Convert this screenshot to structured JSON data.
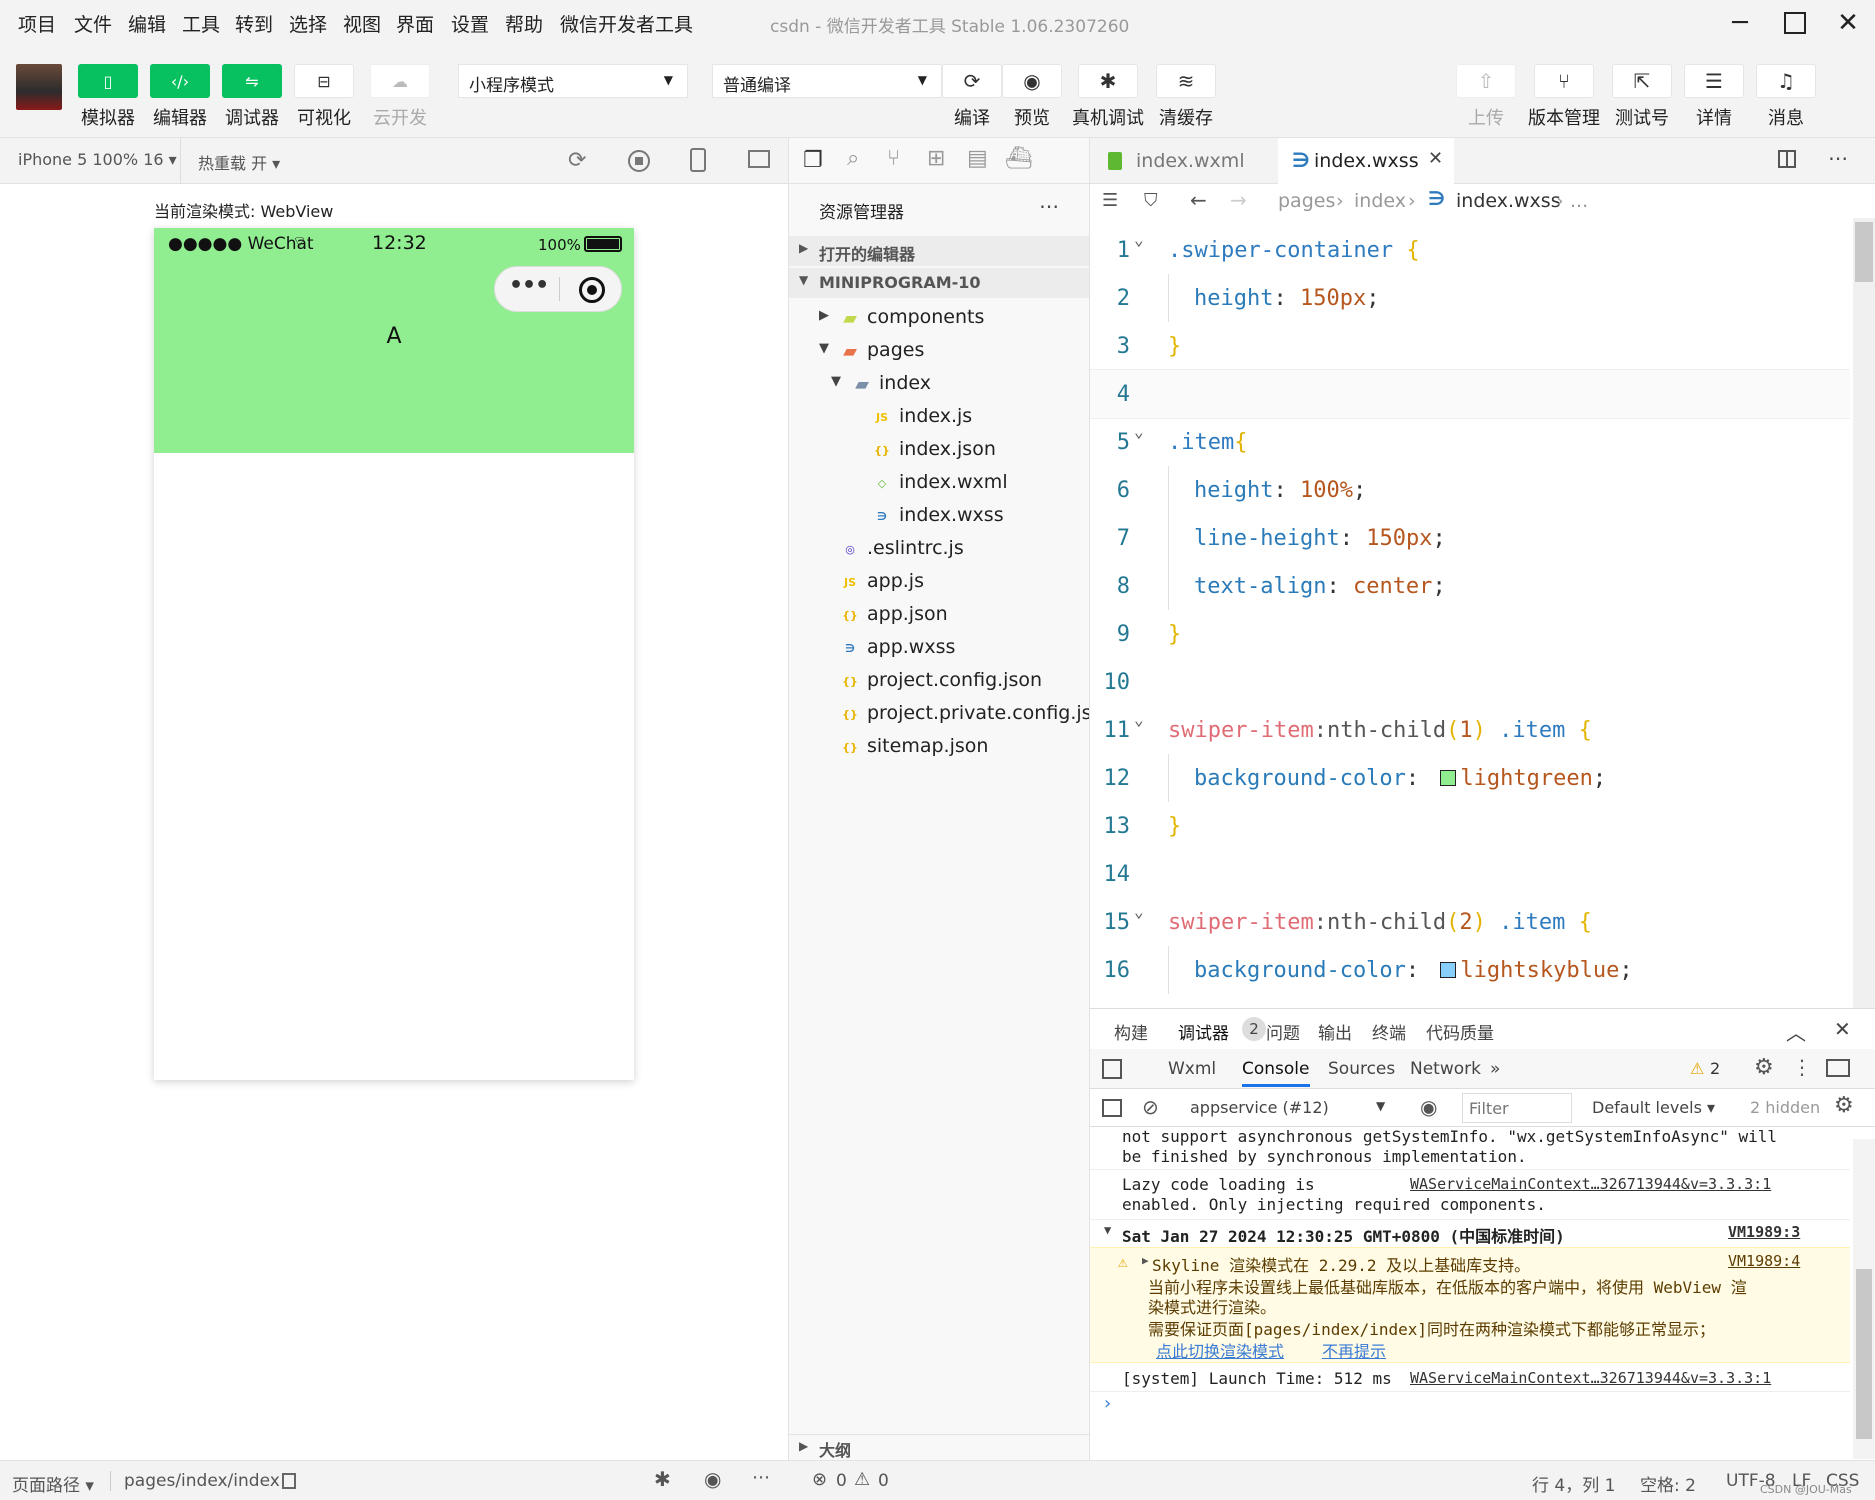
{
  "menubar": {
    "items": [
      "项目",
      "文件",
      "编辑",
      "工具",
      "转到",
      "选择",
      "视图",
      "界面",
      "设置",
      "帮助",
      "微信开发者工具"
    ],
    "title": "csdn - 微信开发者工具 Stable 1.06.2307260"
  },
  "toolbar": {
    "left_buttons": [
      {
        "label": "模拟器",
        "icon": "phone-icon"
      },
      {
        "label": "编辑器",
        "icon": "code-icon"
      },
      {
        "label": "调试器",
        "icon": "debug-sliders-icon"
      },
      {
        "label": "可视化",
        "icon": "layout-icon"
      },
      {
        "label": "云开发",
        "icon": "cloud-icon"
      }
    ],
    "mode_select": "小程序模式",
    "compile_select": "普通编译",
    "mid_buttons": [
      {
        "label": "编译",
        "icon": "refresh-icon"
      },
      {
        "label": "预览",
        "icon": "eye-icon"
      },
      {
        "label": "真机调试",
        "icon": "bug-icon"
      },
      {
        "label": "清缓存",
        "icon": "layers-icon"
      }
    ],
    "right_buttons": [
      {
        "label": "上传",
        "icon": "upload-icon"
      },
      {
        "label": "版本管理",
        "icon": "branch-icon"
      },
      {
        "label": "测试号",
        "icon": "external-link-icon"
      },
      {
        "label": "详情",
        "icon": "menu-icon"
      },
      {
        "label": "消息",
        "icon": "bell-icon"
      }
    ]
  },
  "simulator": {
    "device": "iPhone 5 100% 16 ▾",
    "hot_reload": "热重载 开 ▾",
    "render_mode": "当前渲染模式: WebView",
    "status_carrier": "●●●●● WeChat",
    "status_time": "12:32",
    "status_battery": "100%",
    "swiper_text": "A",
    "swiper_color": "#90ee90"
  },
  "explorer": {
    "title": "资源管理器",
    "open_editors": "打开的编辑器",
    "project": "MINIPROGRAM-10",
    "tree": [
      {
        "name": "components",
        "type": "folder-comp",
        "depth": 1,
        "arrow": "▸"
      },
      {
        "name": "pages",
        "type": "folder-pages",
        "depth": 1,
        "arrow": "▾"
      },
      {
        "name": "index",
        "type": "folder",
        "depth": 2,
        "arrow": "▾"
      },
      {
        "name": "index.js",
        "type": "js",
        "depth": 3,
        "arrow": ""
      },
      {
        "name": "index.json",
        "type": "json",
        "depth": 3,
        "arrow": ""
      },
      {
        "name": "index.wxml",
        "type": "wxml",
        "depth": 3,
        "arrow": ""
      },
      {
        "name": "index.wxss",
        "type": "wxss",
        "depth": 3,
        "arrow": ""
      },
      {
        "name": ".eslintrc.js",
        "type": "eslint",
        "depth": 1,
        "arrow": ""
      },
      {
        "name": "app.js",
        "type": "js",
        "depth": 1,
        "arrow": ""
      },
      {
        "name": "app.json",
        "type": "json",
        "depth": 1,
        "arrow": ""
      },
      {
        "name": "app.wxss",
        "type": "wxss",
        "depth": 1,
        "arrow": ""
      },
      {
        "name": "project.config.json",
        "type": "json",
        "depth": 1,
        "arrow": ""
      },
      {
        "name": "project.private.config.js...",
        "type": "json",
        "depth": 1,
        "arrow": ""
      },
      {
        "name": "sitemap.json",
        "type": "json",
        "depth": 1,
        "arrow": ""
      }
    ],
    "outline": "大纲",
    "problems_errors": "0",
    "problems_warnings": "0"
  },
  "editor": {
    "tabs": [
      {
        "label": "index.wxml",
        "active": false
      },
      {
        "label": "index.wxss",
        "active": true
      }
    ],
    "breadcrumb": [
      "pages",
      "index",
      "index.wxss",
      "..."
    ],
    "lines": [
      {
        "n": "1",
        "tokens": [
          {
            "t": ".swiper-container",
            "c": "k-sel"
          },
          {
            "t": " ",
            "c": ""
          },
          {
            "t": "{",
            "c": "k-br"
          }
        ],
        "indent": false
      },
      {
        "n": "2",
        "tokens": [
          {
            "t": "height",
            "c": "k-prop"
          },
          {
            "t": ": ",
            "c": "k-pun"
          },
          {
            "t": "150px",
            "c": "k-val"
          },
          {
            "t": ";",
            "c": "k-pun"
          }
        ],
        "indent": true
      },
      {
        "n": "3",
        "tokens": [
          {
            "t": "}",
            "c": "k-br"
          }
        ],
        "indent": false
      },
      {
        "n": "4",
        "tokens": [],
        "indent": false
      },
      {
        "n": "5",
        "tokens": [
          {
            "t": ".item",
            "c": "k-sel"
          },
          {
            "t": "{",
            "c": "k-br"
          }
        ],
        "indent": false
      },
      {
        "n": "6",
        "tokens": [
          {
            "t": "height",
            "c": "k-prop"
          },
          {
            "t": ": ",
            "c": "k-pun"
          },
          {
            "t": "100%",
            "c": "k-val"
          },
          {
            "t": ";",
            "c": "k-pun"
          }
        ],
        "indent": true
      },
      {
        "n": "7",
        "tokens": [
          {
            "t": "line-height",
            "c": "k-prop"
          },
          {
            "t": ": ",
            "c": "k-pun"
          },
          {
            "t": "150px",
            "c": "k-val"
          },
          {
            "t": ";",
            "c": "k-pun"
          }
        ],
        "indent": true
      },
      {
        "n": "8",
        "tokens": [
          {
            "t": "text-align",
            "c": "k-prop"
          },
          {
            "t": ": ",
            "c": "k-pun"
          },
          {
            "t": "center",
            "c": "k-val"
          },
          {
            "t": ";",
            "c": "k-pun"
          }
        ],
        "indent": true
      },
      {
        "n": "9",
        "tokens": [
          {
            "t": "}",
            "c": "k-br"
          }
        ],
        "indent": false
      },
      {
        "n": "10",
        "tokens": [],
        "indent": false
      },
      {
        "n": "11",
        "tokens": [
          {
            "t": "swiper-item",
            "c": "k-tag"
          },
          {
            "t": ":nth-child",
            "c": "k-fn"
          },
          {
            "t": "(",
            "c": "k-br"
          },
          {
            "t": "1",
            "c": "k-val"
          },
          {
            "t": ")",
            "c": "k-br"
          },
          {
            "t": " .item ",
            "c": "k-sel"
          },
          {
            "t": "{",
            "c": "k-br"
          }
        ],
        "indent": false
      },
      {
        "n": "12",
        "tokens": [
          {
            "t": "background-color",
            "c": "k-prop"
          },
          {
            "t": ": ",
            "c": "k-pun"
          },
          {
            "t": "■",
            "c": "sw-green"
          },
          {
            "t": "lightgreen",
            "c": "k-val"
          },
          {
            "t": ";",
            "c": "k-pun"
          }
        ],
        "indent": true
      },
      {
        "n": "13",
        "tokens": [
          {
            "t": "}",
            "c": "k-br"
          }
        ],
        "indent": false
      },
      {
        "n": "14",
        "tokens": [],
        "indent": false
      },
      {
        "n": "15",
        "tokens": [
          {
            "t": "swiper-item",
            "c": "k-tag"
          },
          {
            "t": ":nth-child",
            "c": "k-fn"
          },
          {
            "t": "(",
            "c": "k-br"
          },
          {
            "t": "2",
            "c": "k-val"
          },
          {
            "t": ")",
            "c": "k-br"
          },
          {
            "t": " .item ",
            "c": "k-sel"
          },
          {
            "t": "{",
            "c": "k-br"
          }
        ],
        "indent": false
      },
      {
        "n": "16",
        "tokens": [
          {
            "t": "background-color",
            "c": "k-prop"
          },
          {
            "t": ": ",
            "c": "k-pun"
          },
          {
            "t": "■",
            "c": "sw-blue"
          },
          {
            "t": "lightskyblue",
            "c": "k-val"
          },
          {
            "t": ";",
            "c": "k-pun"
          }
        ],
        "indent": true
      }
    ]
  },
  "debugger": {
    "panel_tabs": [
      "构建",
      "调试器",
      "问题",
      "输出",
      "终端",
      "代码质量"
    ],
    "debugger_badge": "2",
    "devtools_tabs": [
      "Wxml",
      "Console",
      "Sources",
      "Network",
      "»"
    ],
    "warning_count": "2",
    "context_select": "appservice (#12)",
    "filter_placeholder": "Filter",
    "levels": "Default levels ▾",
    "hidden": "2 hidden",
    "console": {
      "line1a": "not support asynchronous getSystemInfo. \"wx.getSystemInfoAsync\" will",
      "line1b": "be finished by synchronous implementation.",
      "line2a": "Lazy code loading is",
      "line2b": "enabled. Only injecting required components.",
      "line2_src": "WAServiceMainContext…326713944&v=3.3.3:1",
      "group_title": "Sat Jan 27 2024 12:30:25 GMT+0800 (中国标准时间)",
      "group_src": "VM1989:3",
      "warn_line1": "Skyline 渲染模式在 2.29.2 及以上基础库支持。",
      "warn_src": "VM1989:4",
      "warn_line2": "当前小程序未设置线上最低基础库版本，在低版本的客户端中，将使用 WebView 渲",
      "warn_line3": "染模式进行渲染。",
      "warn_line4": "需要保证页面[pages/index/index]同时在两种渲染模式下都能够正常显示；",
      "warn_link1": "点此切换渲染模式",
      "warn_link2": "不再提示",
      "launch": "[system] Launch Time: 512 ms",
      "launch_src": "WAServiceMainContext…326713944&v=3.3.3:1",
      "prompt": "›"
    }
  },
  "statusbar": {
    "page_path_label": "页面路径 ▾",
    "page_path": "pages/index/index",
    "cursor": "行 4，列 1",
    "spaces": "空格: 2",
    "encoding": "UTF-8",
    "eol": "LF",
    "lang": "CSS",
    "watermark": "CSDN @JOU-Mas"
  }
}
